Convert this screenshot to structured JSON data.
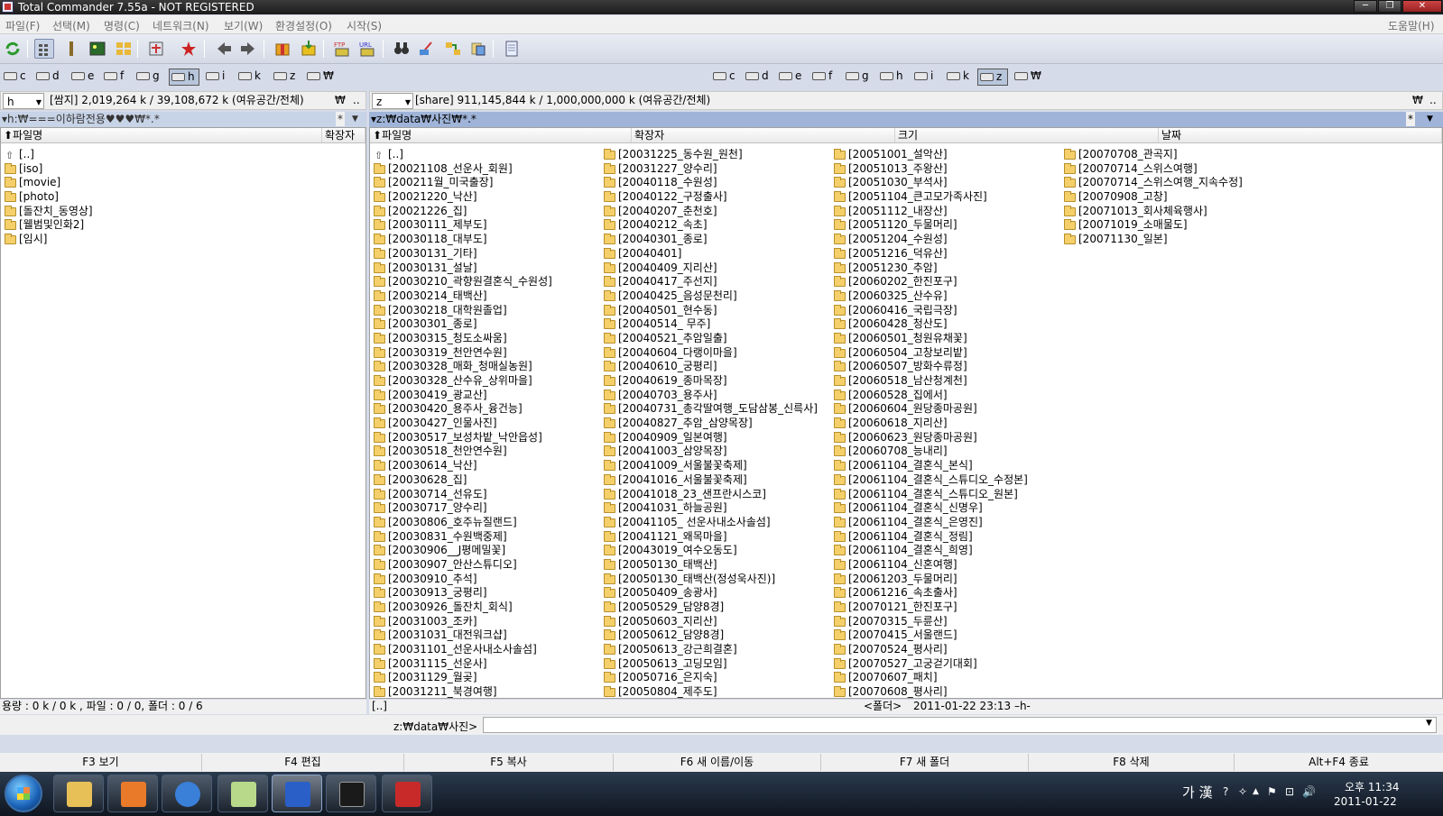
{
  "window": {
    "title": "Total Commander 7.55a - NOT REGISTERED",
    "controls": [
      "─",
      "❐",
      "✕"
    ]
  },
  "menu": [
    "파일(F)",
    "선택(M)",
    "명령(C)",
    "네트워크(N)",
    "보기(W)",
    "환경설정(O)",
    "시작(S)"
  ],
  "menu_help": "도움말(H)",
  "left_drives": [
    "c",
    "d",
    "e",
    "f",
    "g",
    "h",
    "i",
    "k",
    "z",
    "₩"
  ],
  "right_drives": [
    "c",
    "d",
    "e",
    "f",
    "g",
    "h",
    "i",
    "k",
    "z",
    "₩"
  ],
  "left_info": {
    "drive": "h",
    "text": "[쌈지]  2,019,264 k / 39,108,672 k (여유공간/전체)",
    "root": "₩",
    "up": ".."
  },
  "right_info": {
    "drive": "z",
    "text": "[share]  911,145,844 k / 1,000,000,000 k (여유공간/전체)",
    "root": "₩",
    "up": ".."
  },
  "left_path": "▾h:₩===이하람전용♥♥♥₩*.*",
  "right_path": "▾z:₩data₩사진₩*.*",
  "path_star": "*",
  "path_arrow": "▼",
  "left_columns": {
    "name": "⬆파일명",
    "ext": "확장자"
  },
  "right_columns": {
    "name": "⬆파일명",
    "ext": "확장자",
    "size": "크기",
    "date": "날짜"
  },
  "left_files": [
    "[..]",
    "[iso]",
    "[movie]",
    "[photo]",
    "[돌잔치_동영상]",
    "[웰범및인화2]",
    "[임시]"
  ],
  "right_files_col1": [
    "[..]",
    "[20021108_선운사_회원]",
    "[200211월_미국출장]",
    "[20021220_낙산]",
    "[20021226_집]",
    "[20030111_제부도]",
    "[20030118_대부도]",
    "[20030131_기타]",
    "[20030131_설날]",
    "[20030210_곽향원결혼식_수원성]",
    "[20030214_태백산]",
    "[20030218_대학원졸업]",
    "[20030301_종로]",
    "[20030315_청도소싸움]",
    "[20030319_천안연수원]",
    "[20030328_매화_청매실농원]",
    "[20030328_산수유_상위마을]",
    "[20030419_광교산]",
    "[20030420_용주사_융건능]",
    "[20030427_인물사진]",
    "[20030517_보성차밭_낙안읍성]",
    "[20030518_천안연수원]",
    "[20030614_낙산]",
    "[20030628_집]",
    "[20030714_선유도]",
    "[20030717_양수리]",
    "[20030806_호주뉴질랜드]",
    "[20030831_수원백중제]",
    "[20030906__J평메밀꽃]",
    "[20030907_안산스튜디오]",
    "[20030910_추석]",
    "[20030913_궁평리]",
    "[20030926_돌잔치_회식]",
    "[20031003_조카]",
    "[20031031_대전워크샵]",
    "[20031101_선운사내소사솔섬]",
    "[20031115_선운사]",
    "[20031129_월곶]",
    "[20031211_북경여행]"
  ],
  "right_files_col2": [
    "[20031225_동수원_원천]",
    "[20031227_양수리]",
    "[20040118_수원성]",
    "[20040122_구정출사]",
    "[20040207_춘천호]",
    "[20040212_속초]",
    "[20040301_종로]",
    "[20040401]",
    "[20040409_지리산]",
    "[20040417_주선지]",
    "[20040425_음성문천리]",
    "[20040501_현수동]",
    "[20040514_ 무주]",
    "[20040521_추암일출]",
    "[20040604_다랭이마을]",
    "[20040610_궁평리]",
    "[20040619_종마목장]",
    "[20040703_용주사]",
    "[20040731_총각딸여행_도담삼봉_신륵사]",
    "[20040827_추암_삼양목장]",
    "[20040909_일본여행]",
    "[20041003_삼양목장]",
    "[20041009_서울불꽃축제]",
    "[20041016_서울불꽃축제]",
    "[20041018_23_샌프란시스코]",
    "[20041031_하늘공원]",
    "[20041105_ 선운사내소사솔섬]",
    "[20041121_왜목마을]",
    "[20043019_여수오동도]",
    "[20050130_태백산]",
    "[20050130_태백산(정성욱사진)]",
    "[20050409_송광사]",
    "[20050529_담양8경]",
    "[20050603_지리산]",
    "[20050612_담양8경]",
    "[20050613_강근희결혼]",
    "[20050613_고딩모임]",
    "[20050716_은지숙]",
    "[20050804_제주도]"
  ],
  "right_files_col3": [
    "[20051001_설악산]",
    "[20051013_주왕산]",
    "[20051030_부석사]",
    "[20051104_큰고모가족사진]",
    "[20051112_내장산]",
    "[20051120_두물머리]",
    "[20051204_수원성]",
    "[20051216_덕유산]",
    "[20051230_추암]",
    "[20060202_한진포구]",
    "[20060325_산수유]",
    "[20060416_국립극장]",
    "[20060428_청산도]",
    "[20060501_청원유채꽃]",
    "[20060504_고창보리밭]",
    "[20060507_방화수류정]",
    "[20060518_남산청계천]",
    "[20060528_집에서]",
    "[20060604_원당종마공원]",
    "[20060618_지리산]",
    "[20060623_원당종마공원]",
    "[20060708_능내리]",
    "[20061104_결혼식_본식]",
    "[20061104_결혼식_스튜디오_수정본]",
    "[20061104_결혼식_스튜디오_원본]",
    "[20061104_결혼식_신명우]",
    "[20061104_결혼식_은영진]",
    "[20061104_결혼식_정림]",
    "[20061104_결혼식_희영]",
    "[20061104_신혼여행]",
    "[20061203_두물머리]",
    "[20061216_속초출사]",
    "[20070121_한진포구]",
    "[20070315_두륜산]",
    "[20070415_서울랜드]",
    "[20070524_평사리]",
    "[20070527_고궁걷기대회]",
    "[20070607_패치]",
    "[20070608_평사리]"
  ],
  "right_files_col4": [
    "[20070708_관곡지]",
    "[20070714_스위스여행]",
    "[20070714_스위스여행_지속수정]",
    "[20070908_고창]",
    "[20071013_회사체육행사]",
    "[20071019_소매물도]",
    "[20071130_일본]"
  ],
  "left_status": "용량 : 0 k / 0 k , 파일 : 0 / 0, 폴더 : 0 / 6",
  "right_status": {
    "name": "[..]",
    "type": "<폴더>",
    "datetime": "2011-01-22 23:13 –h-"
  },
  "command": {
    "label": "z:₩data₩사진>",
    "value": "",
    "dropdown": "▼"
  },
  "fkeys": [
    "F3 보기",
    "F4 편집",
    "F5 복사",
    "F6 새 이름/이동",
    "F7 새 폴더",
    "F8 삭제",
    "Alt+F4 종료"
  ],
  "taskbar": {
    "ime": "가 漢",
    "time": "오후 11:34",
    "date": "2011-01-22",
    "tray_icons": [
      "?",
      "✧",
      "▲",
      "⚑",
      "⊡",
      "🔊"
    ],
    "app_colors": [
      "#e8c058",
      "#e87a2a",
      "#3a7fd8",
      "#b8d88a",
      "#2a5fc8",
      "#1a1a1a",
      "#c82a2a"
    ]
  }
}
